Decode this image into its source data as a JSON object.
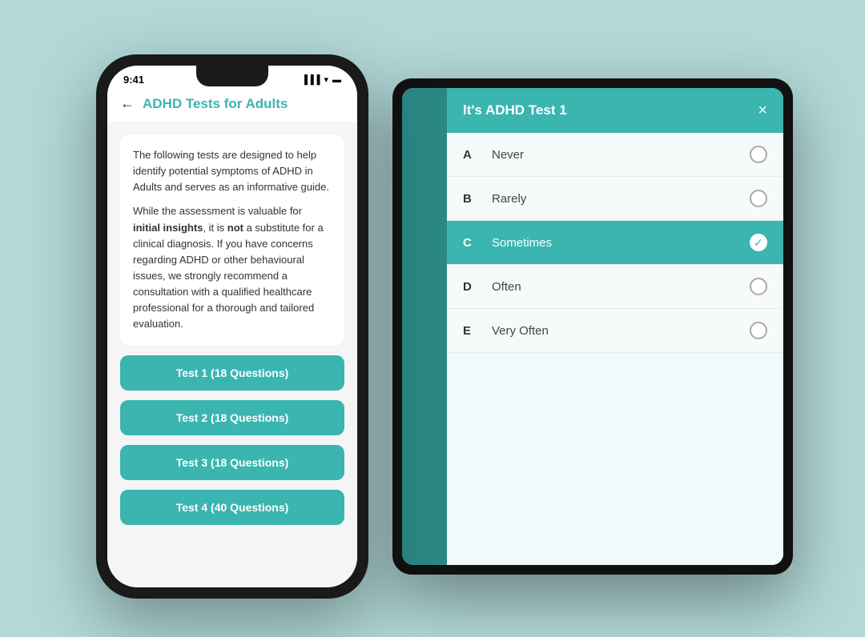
{
  "background_color": "#b2d8d8",
  "accent_color": "#3ab5b0",
  "phone": {
    "time": "9:41",
    "header": {
      "back_label": "←",
      "title": "ADHD Tests for Adults"
    },
    "info_card": {
      "paragraph1": "The following tests are designed to help identify potential symptoms of ADHD in Adults and serves as an informative guide.",
      "paragraph2_pre": "While the assessment is valuable for ",
      "paragraph2_bold": "initial insights",
      "paragraph2_mid": ", it is ",
      "paragraph2_bold2": "not",
      "paragraph2_post": " a substitute for a clinical diagnosis. If you have concerns regarding ADHD or other behavioural issues, we strongly recommend a consultation with a qualified healthcare professional for a thorough and tailored evaluation."
    },
    "buttons": [
      {
        "label": "Test 1 (18 Questions)"
      },
      {
        "label": "Test 2 (18 Questions)"
      },
      {
        "label": "Test 3 (18 Questions)"
      },
      {
        "label": "Test 4 (40 Questions)"
      }
    ]
  },
  "tablet": {
    "modal": {
      "title": "lt's ADHD Test 1",
      "close_label": "×",
      "options": [
        {
          "letter": "A",
          "text": "Never",
          "selected": false
        },
        {
          "letter": "B",
          "text": "Rarely",
          "selected": false
        },
        {
          "letter": "C",
          "text": "Sometimes",
          "selected": true
        },
        {
          "letter": "D",
          "text": "Often",
          "selected": false
        },
        {
          "letter": "E",
          "text": "Very Often",
          "selected": false
        }
      ]
    }
  }
}
